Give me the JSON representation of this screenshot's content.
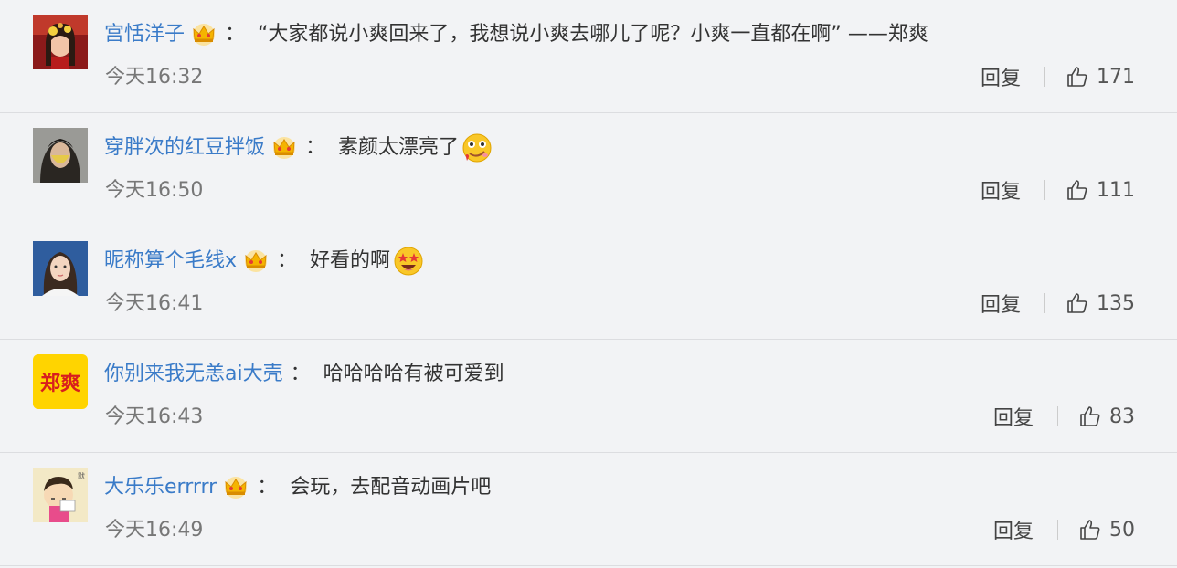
{
  "comments": [
    {
      "avatar_icon": "avatar-girl-red",
      "username": "宫恬洋子",
      "badge_icon": "vip-crown-icon",
      "colon": "：",
      "text": "“大家都说小爽回来了，我想说小爽去哪儿了呢？小爽一直都在啊” ——郑爽",
      "emoji": "",
      "time": "今天16:32",
      "reply_label": "回复",
      "likes": "171"
    },
    {
      "avatar_icon": "avatar-mask-girl",
      "username": "穿胖次的红豆拌饭",
      "badge_icon": "vip-crown-icon",
      "colon": "：",
      "text": "素颜太漂亮了",
      "emoji": "drooling-face-emoji",
      "time": "今天16:50",
      "reply_label": "回复",
      "likes": "111"
    },
    {
      "avatar_icon": "avatar-girl-blue",
      "username": "昵称算个毛线x",
      "badge_icon": "vip-crown-icon",
      "colon": "：",
      "text": "好看的啊",
      "emoji": "star-struck-emoji",
      "time": "今天16:41",
      "reply_label": "回复",
      "likes": "135"
    },
    {
      "avatar_icon": "avatar-text-yellow",
      "avatar_text": "郑爽",
      "username": "你别来我无恙ai大壳",
      "badge_icon": "",
      "colon": "：",
      "text": "哈哈哈哈有被可爱到",
      "emoji": "",
      "time": "今天16:43",
      "reply_label": "回复",
      "likes": "83"
    },
    {
      "avatar_icon": "avatar-cartoon-boy",
      "username": "大乐乐errrrr",
      "badge_icon": "vip-crown-icon",
      "colon": "：",
      "text": "会玩，去配音动画片吧",
      "emoji": "",
      "time": "今天16:49",
      "reply_label": "回复",
      "likes": "50"
    }
  ],
  "colors": {
    "username": "#3a7bc8",
    "background": "#f2f3f5",
    "crown": "#f5b400"
  }
}
